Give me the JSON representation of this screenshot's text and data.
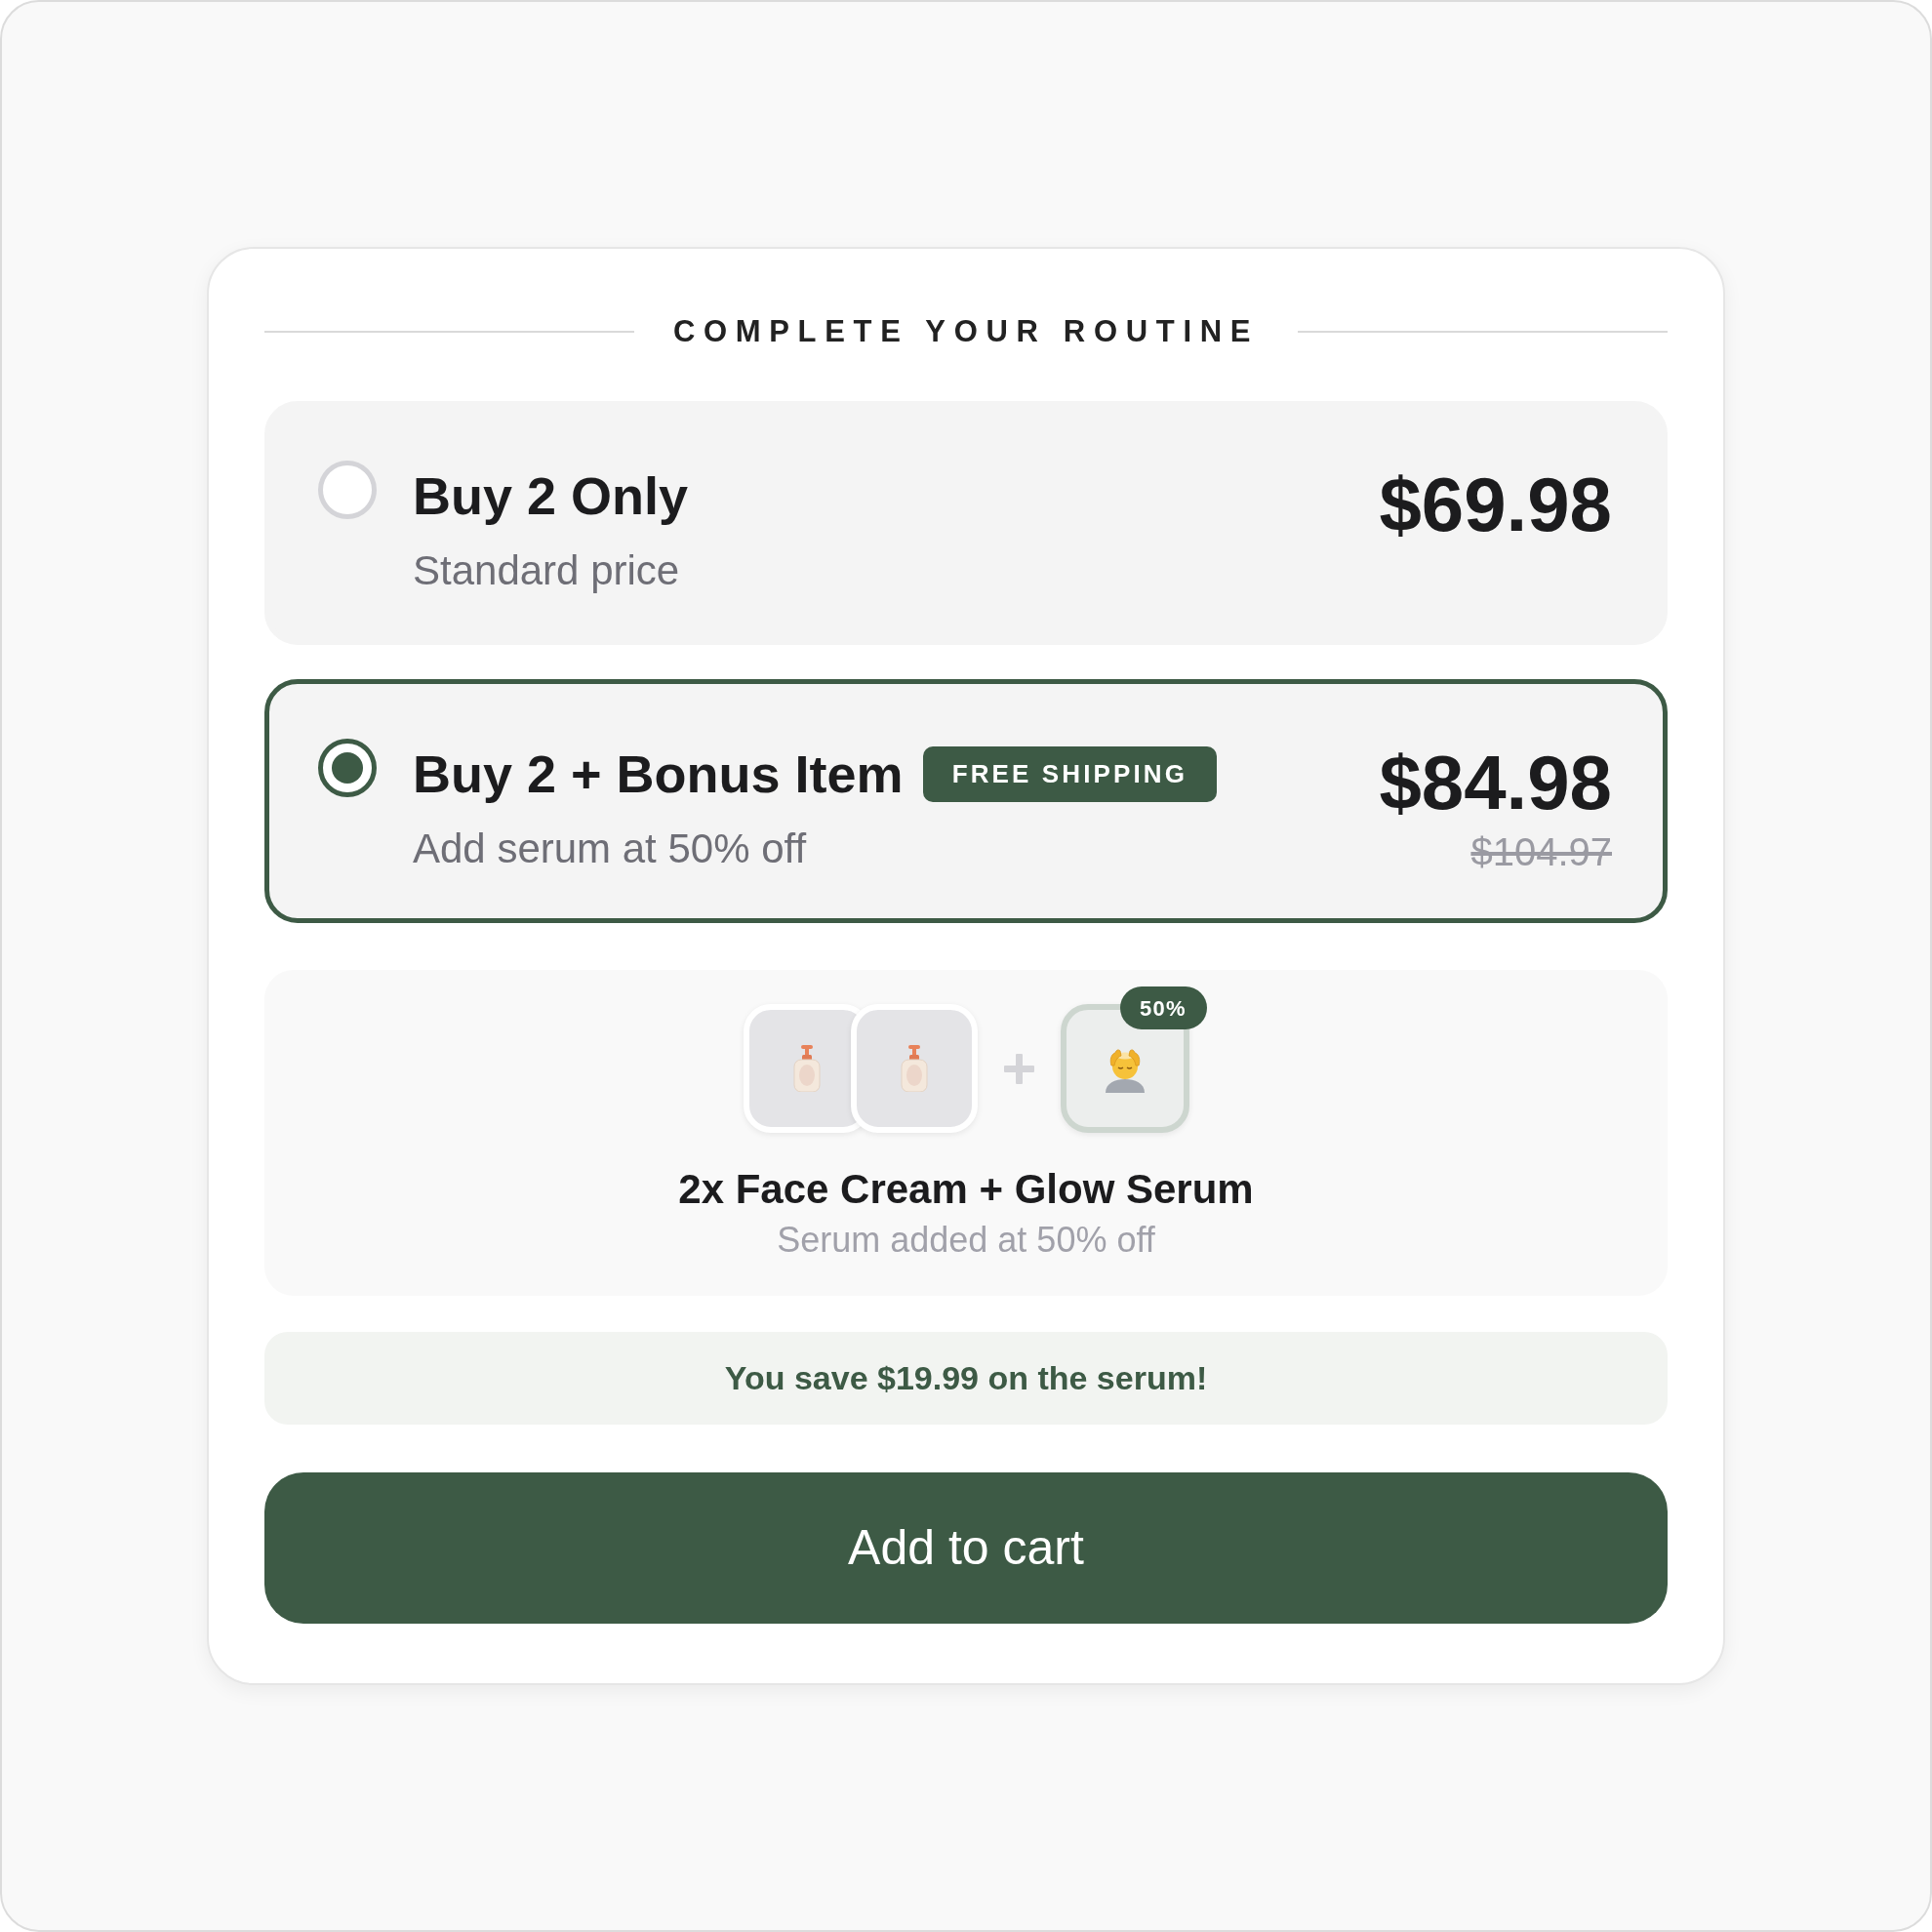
{
  "header": {
    "title": "COMPLETE YOUR ROUTINE"
  },
  "options": [
    {
      "title": "Buy 2 Only",
      "subtitle": "Standard price",
      "price": "$69.98",
      "selected": false
    },
    {
      "title": "Buy 2 + Bonus Item",
      "badge": "FREE SHIPPING",
      "subtitle": "Add serum at 50% off",
      "price": "$84.98",
      "original_price": "$104.97",
      "selected": true
    }
  ],
  "bundle": {
    "base_items": [
      {
        "kind": "bottle"
      },
      {
        "kind": "bottle"
      }
    ],
    "bonus_items": [
      {
        "kind": "massage",
        "badge": "50%"
      }
    ],
    "title": "2x Face Cream + Glow Serum",
    "subtitle": "Serum added at 50% off"
  },
  "savings": {
    "text": "You save $19.99 on the serum!"
  },
  "cart_button": {
    "label": "Add to cart"
  }
}
